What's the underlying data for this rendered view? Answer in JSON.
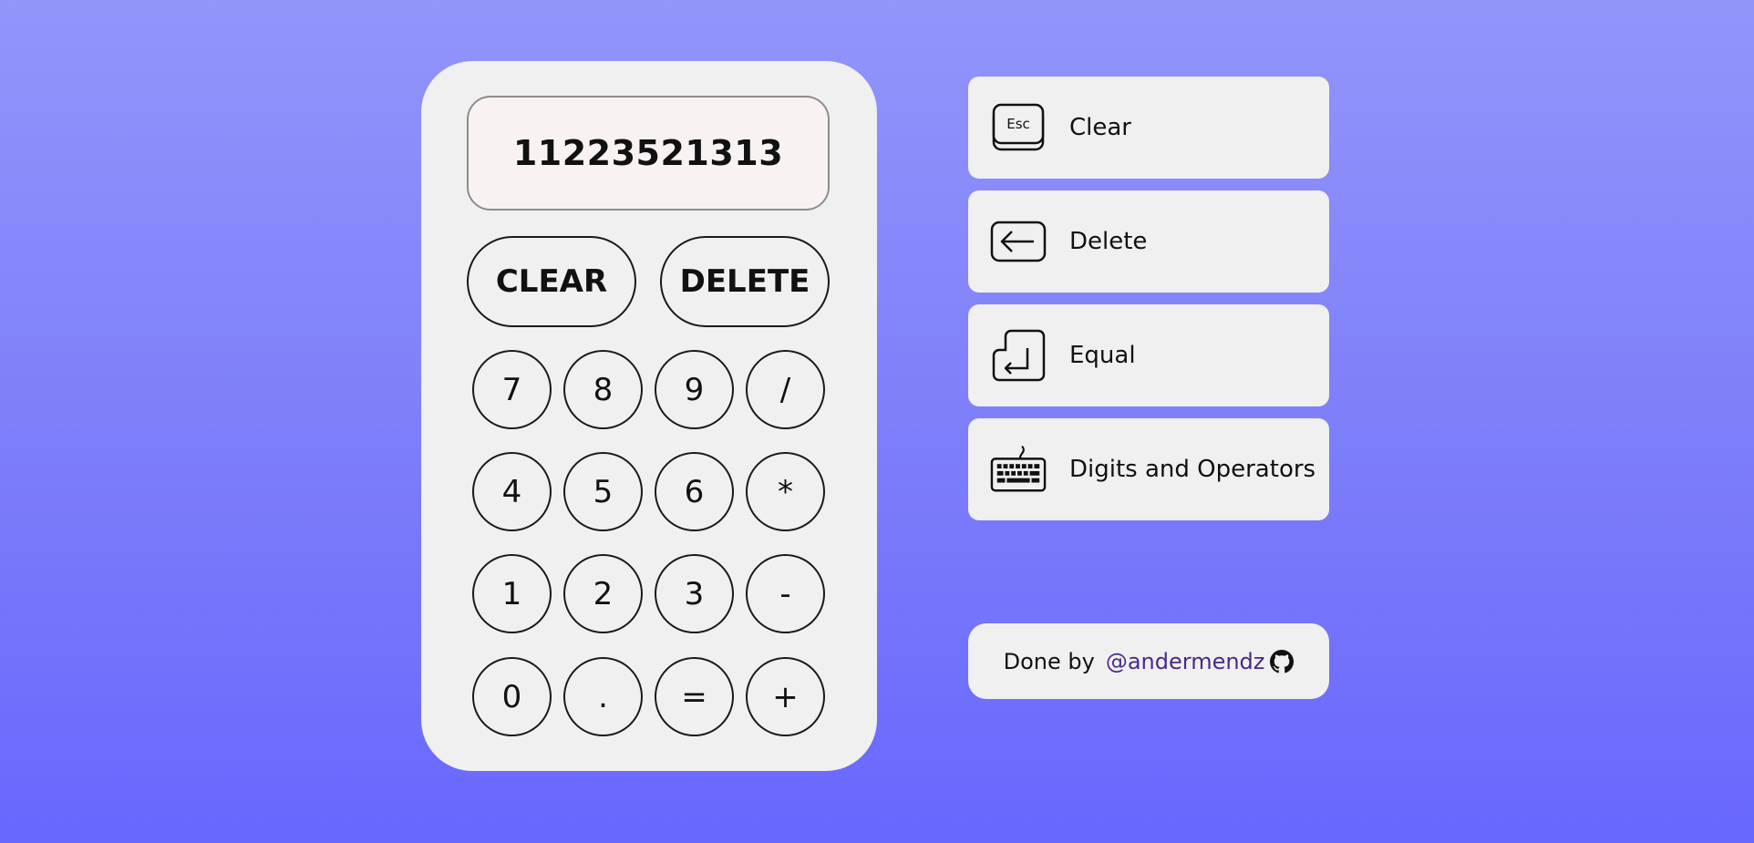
{
  "display": {
    "value": "11223521313"
  },
  "controls": {
    "clear_label": "CLEAR",
    "delete_label": "DELETE"
  },
  "keypad": {
    "rows": [
      [
        "7",
        "8",
        "9",
        "/"
      ],
      [
        "4",
        "5",
        "6",
        "*"
      ],
      [
        "1",
        "2",
        "3",
        "-"
      ],
      [
        "0",
        ".",
        "=",
        "+"
      ]
    ]
  },
  "shortcuts": [
    {
      "icon": "esc-key-icon",
      "key_text": "Esc",
      "label": "Clear"
    },
    {
      "icon": "backspace-key-icon",
      "label": "Delete"
    },
    {
      "icon": "enter-key-icon",
      "label": "Equal"
    },
    {
      "icon": "keyboard-icon",
      "label": "Digits and Operators"
    }
  ],
  "credit": {
    "prefix": "Done by",
    "handle": "@andermendz",
    "icon": "github-icon"
  },
  "colors": {
    "background_top": "#9295fa",
    "background_bottom": "#6867fe",
    "panel": "#f0f0f0",
    "display_bg": "#f8f3f2",
    "handle_link": "#4a2a86"
  }
}
